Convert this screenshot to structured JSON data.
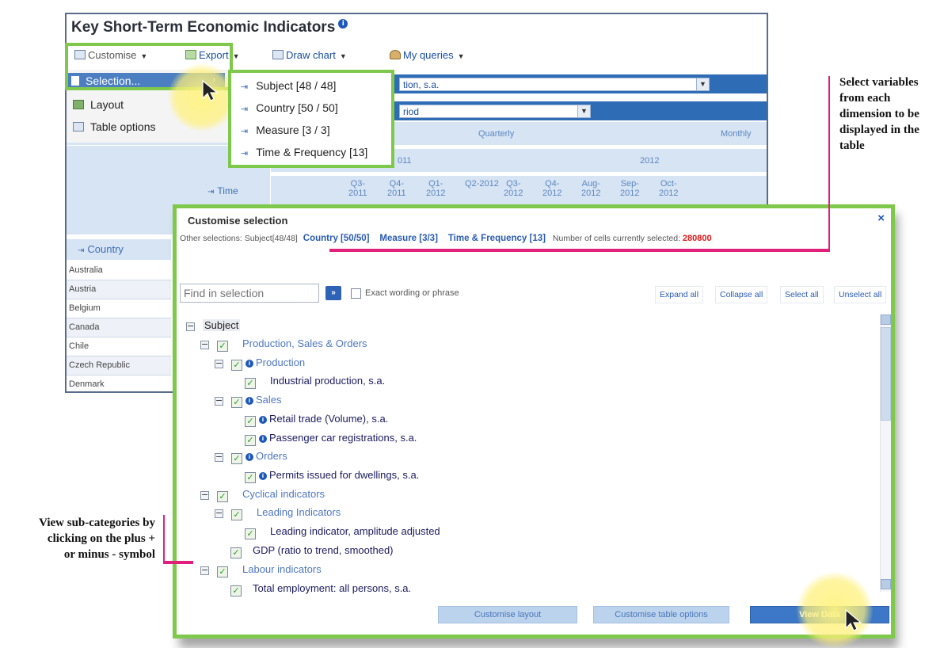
{
  "app": {
    "title": "Key Short-Term Economic Indicators",
    "title_info": "i",
    "toolbar": {
      "customise": "Customise",
      "export": "Export",
      "draw_chart": "Draw chart",
      "my_queries": "My queries"
    },
    "filter1_value": "tion, s.a.",
    "filter2_value": "riod",
    "headers": {
      "quarterly": "Quarterly",
      "monthly": "Monthly",
      "year_2011": "011",
      "year_2012": "2012",
      "time": "Time",
      "country": "Country",
      "periods": [
        "Q3-\n2011",
        "Q4-\n2011",
        "Q1-\n2012",
        "Q2-2012",
        "Q3-\n2012",
        "Q4-\n2012",
        "Aug-\n2012",
        "Sep-\n2012",
        "Oct-\n2012"
      ]
    },
    "countries": [
      "Australia",
      "Austria",
      "Belgium",
      "Canada",
      "Chile",
      "Czech Republic",
      "Denmark"
    ],
    "menu": {
      "selection": "Selection...",
      "layout": "Layout",
      "table_options": "Table options"
    },
    "submenu": [
      "Subject [48 / 48]",
      "Country [50 / 50]",
      "Measure [3 / 3]",
      "Time & Frequency [13]"
    ]
  },
  "dialog": {
    "title": "Customise selection",
    "close": "×",
    "other_selections_label": "Other selections: Subject[48/48]",
    "country_link": "Country [50/50]",
    "measure_link": "Measure [3/3]",
    "time_link": "Time & Frequency [13]",
    "cells_label": "Number of cells currently selected:",
    "cells_count": "280800",
    "find_placeholder": "Find in selection",
    "go": "»",
    "exact_label": "Exact wording or phrase",
    "expand_all": "Expand all",
    "collapse_all": "Collapse all",
    "select_all": "Select all",
    "unselect_all": "Unselect all",
    "tree": {
      "root": "Subject",
      "production_sales_orders": "Production, Sales & Orders",
      "production": "Production",
      "industrial_production": "Industrial production, s.a.",
      "sales": "Sales",
      "retail_trade": "Retail trade (Volume), s.a.",
      "passenger_car": "Passenger car registrations, s.a.",
      "orders": "Orders",
      "permits": "Permits issued for dwellings, s.a.",
      "cyclical": "Cyclical indicators",
      "leading": "Leading Indicators",
      "leading_amplitude": "Leading indicator, amplitude adjusted",
      "gdp": "GDP (ratio to trend, smoothed)",
      "labour": "Labour indicators",
      "total_employment": "Total employment: all persons, s.a."
    },
    "buttons": {
      "customise_layout": "Customise layout",
      "customise_table_options": "Customise table options",
      "view_data": "View Data"
    }
  },
  "annotations": {
    "top_right": [
      "Select variables",
      "from each",
      "dimension to be",
      "displayed in the",
      "table"
    ],
    "bottom_left": [
      "View sub-categories by",
      "clicking on the plus +",
      "or minus - symbol"
    ]
  },
  "colors": {
    "highlight_green": "#7ec84c",
    "annotation_pink": "#e0207a",
    "header_blue": "#2e6db6",
    "cell_count_red": "#e01818"
  }
}
